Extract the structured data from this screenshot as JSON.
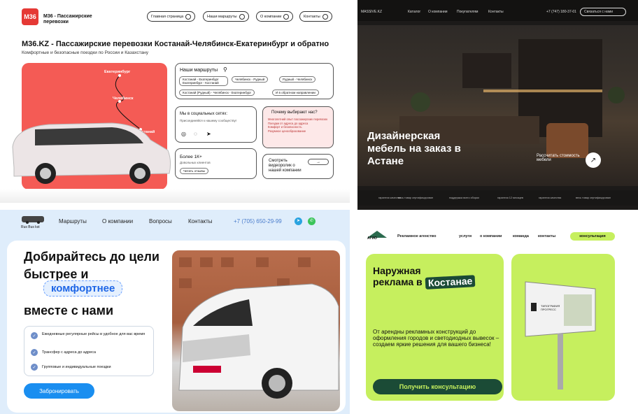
{
  "m36": {
    "logo": "M36",
    "brand": "M36 - Пассажирские перевозки",
    "nav": [
      "Главная страница",
      "Наши маршруты",
      "О компании",
      "Контакты"
    ],
    "title": "M36.KZ - Пассажирские перевозки Костанай-Челябинск-Екатеринбург и обратно",
    "subtitle": "Комфортные и безопасные поездки по России и Казахстану",
    "cities": [
      "Екатеринбург",
      "Челябинск",
      "Костанай"
    ],
    "routes_title": "Наши маршруты",
    "routes": [
      "Костанай - Екатеринбург\nЕкатеринбург - Костанай",
      "Челябинск - Рудный",
      "Рудный - Челябинск",
      "Костанай (Рудный) - Челябинск - Екатеринбург",
      "И в обратном направлении"
    ],
    "social_title": "Мы в социальных сетях:",
    "social_sub": "Присоединяйся к нашему сообществу!",
    "why_title": "Почему выбирают нас?",
    "why": [
      "Многолетний опыт пассажирских перевозок",
      "Поездки от адреса до адреса",
      "Комфорт и безопасность",
      "Разумное ценообразование"
    ],
    "more_title": "Более 1К+",
    "more_sub": "Довольных клиентов",
    "more_link": "Читать отзывы",
    "video": "Смотреть видеоролик о нашей компании"
  },
  "massive": {
    "logo": "MASSIVE.KZ",
    "nav": [
      "Каталог",
      "О компании",
      "Покупателям",
      "Контакты"
    ],
    "phone": "+7 (747) 180-37-01",
    "contact_btn": "Связаться с нами",
    "title": "Дизайнерская мебель на заказ в Астане",
    "calc": "Рассчитать стоимость мебели",
    "strip": [
      "гарантия качества",
      "весь товар сертифицирован",
      "поддержка всего сборки",
      "гарантия 12 месяцев",
      "гарантия качества",
      "весь товар сертифицирован"
    ]
  },
  "rusbus": {
    "logo": "Rus Bus kst",
    "nav": [
      "Маршруты",
      "О компании",
      "Вопросы",
      "Контакты"
    ],
    "phone": "+7 (705) 650-29-99",
    "h1a": "Добирайтесь до цели",
    "h1b": "быстрее и",
    "h1c": "комфортнее",
    "h1d": "вместе с нами",
    "features": [
      "Ежедневные регулярные рейсы в удобное для вас время",
      "Трансфер с адреса до адреса",
      "Групповые и индивидуальные поездки"
    ],
    "cta": "Забронировать"
  },
  "ad": {
    "logo": "АГИО",
    "tag": "Рекламное агенство",
    "nav": [
      "услуги",
      "о компании",
      "команда",
      "контакты"
    ],
    "consult": "консультация",
    "title_a": "Наружная",
    "title_b": "реклама в",
    "title_c": "Костанае",
    "text": "От арендны рекламных конструкций до оформления городов и светодиодных вывесок – создаем яркие решения для вашего бизнеса!",
    "btn": "Получить консультацию",
    "billboard": "ТИПОГРАФИЯ ПРОГРЕСС"
  }
}
